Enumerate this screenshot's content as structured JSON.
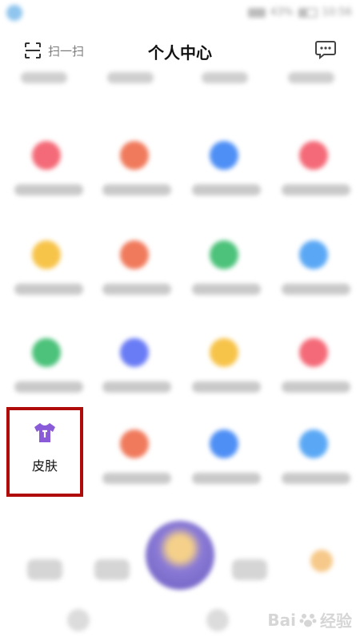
{
  "status_bar": {
    "battery": "43%",
    "time": "10:56"
  },
  "header": {
    "scan_label": "扫一扫",
    "title": "个人中心"
  },
  "grid": {
    "highlighted_item": {
      "label": "皮肤",
      "icon": "shirt-icon",
      "icon_color": "#8a5bd8"
    },
    "blurred_icon_colors": [
      [
        "#f46a78",
        "#f07a5c",
        "#4e8ff5",
        "#f46a78"
      ],
      [
        "#f7c44a",
        "#f07a5c",
        "#4cc27a",
        "#5aa8f5"
      ],
      [
        "#4cc27a",
        "#6a7cf5",
        "#f7c44a",
        "#f46a78"
      ],
      [
        "",
        "#f07a5c",
        "#4e8ff5",
        "#5aa8f5"
      ]
    ]
  },
  "highlight_color": "#b00b0b",
  "watermark": {
    "text": "Bai",
    "text2": "经验"
  }
}
